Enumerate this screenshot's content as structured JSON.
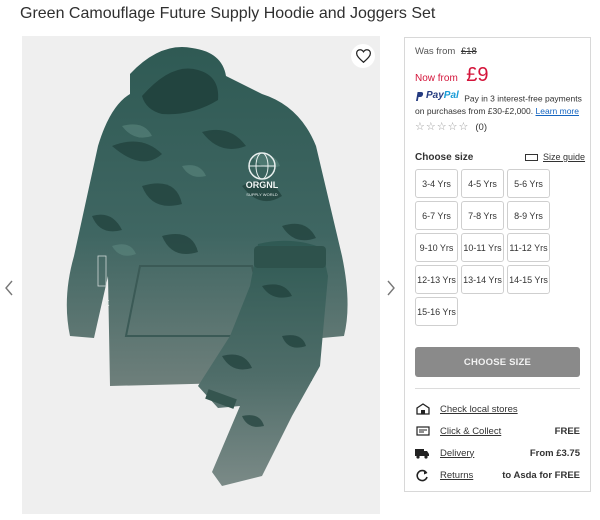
{
  "product": {
    "title": "Green Camouflage Future Supply Hoodie and Joggers Set",
    "graphic_logo_text": "ORGNL",
    "graphic_small_text": "SUPPLY WORLD"
  },
  "gallery": {
    "favourite_icon": "heart-outline-icon",
    "prev_icon": "chevron-left-icon",
    "next_icon": "chevron-right-icon"
  },
  "pricing": {
    "was_label": "Was from",
    "was_price": "£18",
    "now_label": "Now from",
    "now_price": "£9",
    "sale_color": "#d4143a"
  },
  "paypal": {
    "brand_pay": "Pay",
    "brand_pal": "Pal",
    "message": "Pay in 3 interest-free payments on purchases from £30-£2,000.",
    "link": "Learn more"
  },
  "reviews": {
    "stars": 0,
    "count_label": "(0)"
  },
  "size_picker": {
    "label": "Choose size",
    "guide_label": "Size guide",
    "options": [
      "3-4 Yrs",
      "4-5 Yrs",
      "5-6 Yrs",
      "6-7 Yrs",
      "7-8 Yrs",
      "8-9 Yrs",
      "9-10 Yrs",
      "10-11 Yrs",
      "11-12 Yrs",
      "12-13 Yrs",
      "13-14 Yrs",
      "14-15 Yrs",
      "15-16 Yrs"
    ]
  },
  "cta": {
    "label": "CHOOSE SIZE",
    "color": "#8a8a8a"
  },
  "services": [
    {
      "icon": "store-icon",
      "label": "Check local stores",
      "value": ""
    },
    {
      "icon": "click-collect-icon",
      "label": "Click & Collect",
      "value": "FREE"
    },
    {
      "icon": "delivery-truck-icon",
      "label": "Delivery",
      "value": "From £3.75"
    },
    {
      "icon": "returns-icon",
      "label": "Returns",
      "value": "to Asda for FREE"
    }
  ]
}
